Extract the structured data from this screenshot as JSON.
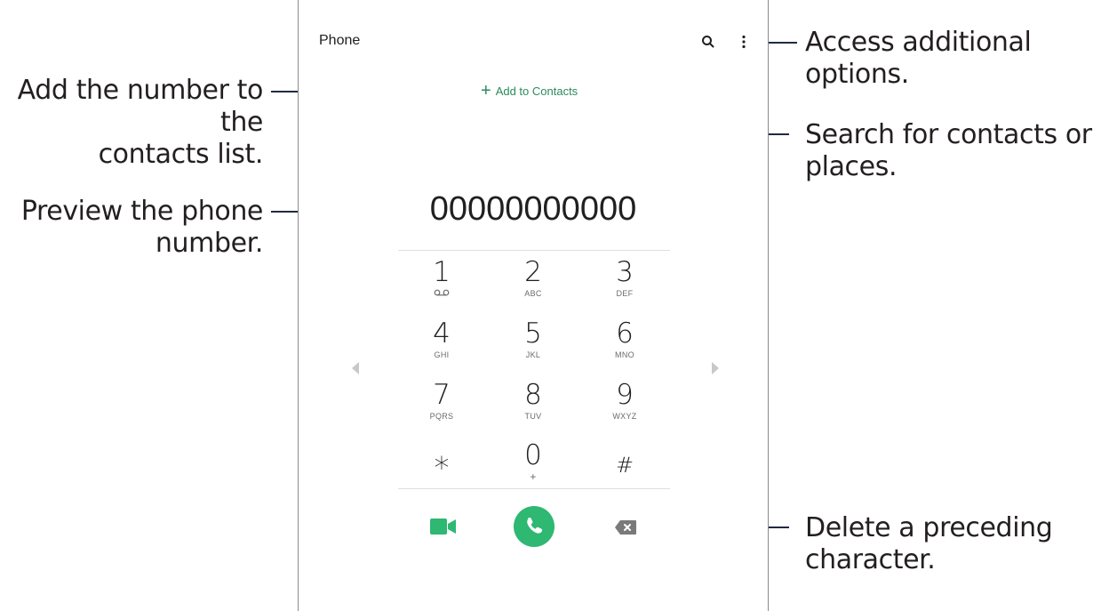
{
  "app": {
    "title": "Phone",
    "add_contacts": "Add to Contacts",
    "number": "00000000000"
  },
  "keypad": {
    "keys": [
      {
        "digit": "1",
        "sub": ""
      },
      {
        "digit": "2",
        "sub": "ABC"
      },
      {
        "digit": "3",
        "sub": "DEF"
      },
      {
        "digit": "4",
        "sub": "GHI"
      },
      {
        "digit": "5",
        "sub": "JKL"
      },
      {
        "digit": "6",
        "sub": "MNO"
      },
      {
        "digit": "7",
        "sub": "PQRS"
      },
      {
        "digit": "8",
        "sub": "TUV"
      },
      {
        "digit": "9",
        "sub": "WXYZ"
      },
      {
        "digit": "⁎",
        "sub": ""
      },
      {
        "digit": "0",
        "sub": "+"
      },
      {
        "digit": "#",
        "sub": ""
      }
    ]
  },
  "callouts": {
    "add_number_line1": "Add the number to the",
    "add_number_line2": "contacts list.",
    "preview_line1": "Preview the phone",
    "preview_line2": "number.",
    "options": "Access additional options.",
    "search_line1": "Search for contacts or",
    "search_line2": "places.",
    "delete_line1": "Delete a preceding",
    "delete_line2": "character."
  },
  "colors": {
    "accent_green": "#2b8a5b",
    "call_green": "#2eb872",
    "video_green": "#2eb872",
    "callout_line": "#1f2a44"
  }
}
